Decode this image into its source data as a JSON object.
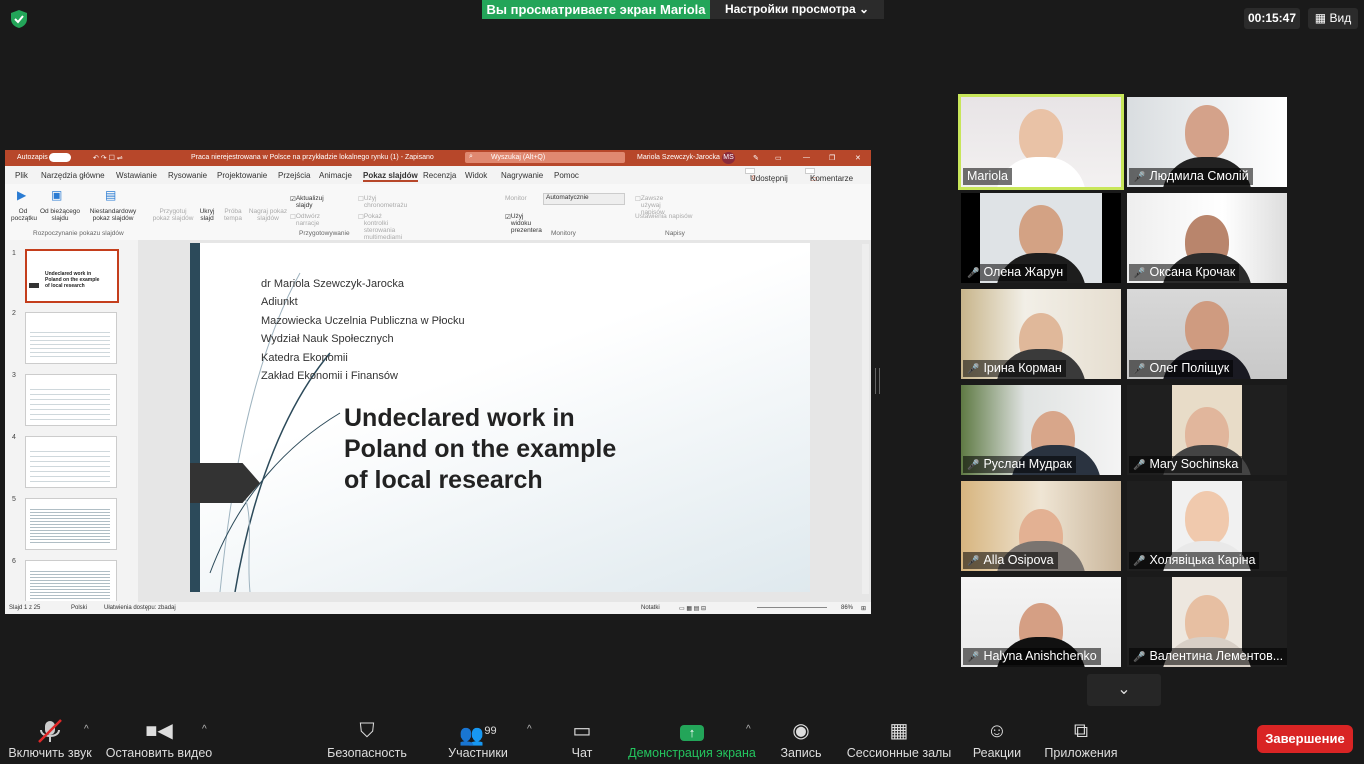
{
  "topbar": {
    "viewing_banner": "Вы просматриваете экран Mariola",
    "view_settings": "Настройки просмотра",
    "timer": "00:15:47",
    "view_button": "Вид"
  },
  "ppt": {
    "autosave_label": "Autozapis",
    "file_title": "Praca nierejestrowana w Polsce na przykładzie lokalnego rynku (1) - Zapisano",
    "search_placeholder": "Wyszukaj (Alt+Q)",
    "user_name": "Mariola Szewczyk-Jarocka",
    "user_initials": "MS",
    "menu": [
      "Plik",
      "Narzędzia główne",
      "Wstawianie",
      "Rysowanie",
      "Projektowanie",
      "Przejścia",
      "Animacje",
      "Pokaz slajdów",
      "Recenzja",
      "Widok",
      "Nagrywanie",
      "Pomoc"
    ],
    "share_label": "Udostępnij",
    "comments_label": "Komentarze",
    "ribbon": {
      "from_start": "Od początku",
      "from_current": "Od bieżącego slajdu",
      "custom_show": "Niestandardowy pokaz slajdów",
      "group_start": "Rozpoczynanie pokazu slajdów",
      "prepare_show": "Przygotuj pokaz slajdów",
      "hide_slide": "Ukryj slajd",
      "rehearse": "Próba tempa",
      "record": "Nagraj pokaz slajdów",
      "update_slides": "Aktualizuj slajdy",
      "play_narration": "Odtwórz narracje",
      "use_timing": "Użyj chronometrażu",
      "show_media": "Pokaż kontrolki sterowania multimediami",
      "group_prepare": "Przygotowywanie",
      "monitor_label": "Monitor",
      "monitor_value": "Automatycznie",
      "presenter_view": "Użyj widoku prezentera",
      "group_monitors": "Monitory",
      "always_captions": "Zawsze używaj napisów",
      "caption_settings": "Ustawienia napisów",
      "group_captions": "Napisy"
    },
    "thumb_numbers": [
      "1",
      "2",
      "3",
      "4",
      "5",
      "6"
    ],
    "slide": {
      "author_lines": [
        "dr Mariola Szewczyk-Jarocka",
        "Adiunkt",
        "Mazowiecka Uczelnia Publiczna w Płocku",
        "Wydział Nauk Społecznych",
        "Katedra Ekonomii",
        "Zakład Ekonomii i Finansów"
      ],
      "title_lines": [
        "Undeclared work in",
        "Poland on the example",
        "of local research"
      ]
    },
    "status": {
      "slide_count": "Slajd 1 z 25",
      "language": "Polski",
      "accessibility": "Ułatwienia dostępu: zbadaj",
      "notes": "Notatki",
      "zoom": "86%"
    }
  },
  "participants": [
    {
      "name": "Mariola",
      "muted": false
    },
    {
      "name": "Людмила Смолій",
      "muted": true
    },
    {
      "name": "Олена Жарун",
      "muted": true
    },
    {
      "name": "Оксана Крочак",
      "muted": true
    },
    {
      "name": "Ірина Корман",
      "muted": true
    },
    {
      "name": "Олег Поліщук",
      "muted": true
    },
    {
      "name": "Руслан Мудрак",
      "muted": true
    },
    {
      "name": "Mary Sochinska",
      "muted": true
    },
    {
      "name": "Alla Osipova",
      "muted": true
    },
    {
      "name": "Холявіцька Каріна",
      "muted": true
    },
    {
      "name": "Halyna Anishchenko",
      "muted": true
    },
    {
      "name": "Валентина Лементов...",
      "muted": true
    }
  ],
  "toolbar": {
    "unmute": "Включить звук",
    "start_video": "Остановить видео",
    "security": "Безопасность",
    "participants": "Участники",
    "participants_count": "99",
    "chat": "Чат",
    "share_screen": "Демонстрация экрана",
    "record": "Запись",
    "breakout": "Сессионные залы",
    "reactions": "Реакции",
    "apps": "Приложения",
    "end": "Завершение"
  },
  "colors": {
    "share_green": "#23a559",
    "end_red": "#d92424",
    "ppt_red": "#b7472a",
    "speaker_outline": "#c8e65a"
  }
}
